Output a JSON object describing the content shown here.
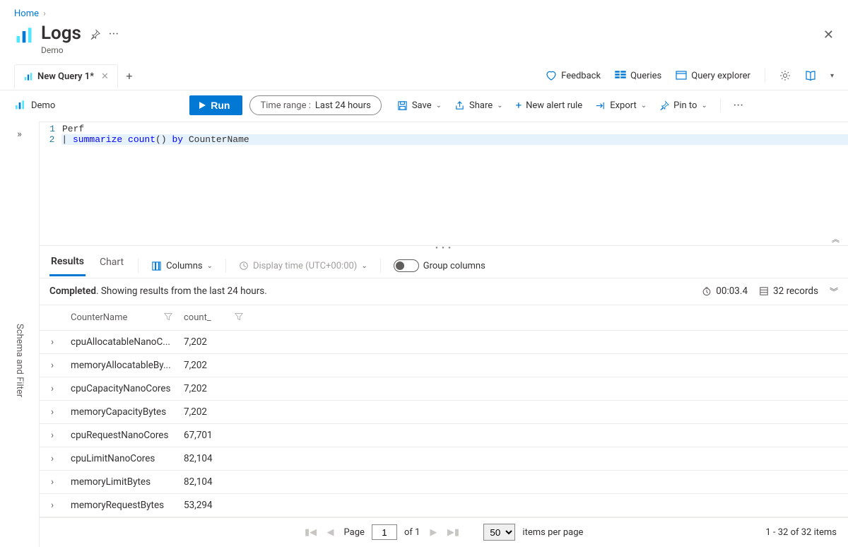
{
  "breadcrumb": {
    "home": "Home"
  },
  "page": {
    "title": "Logs",
    "subtitle": "Demo"
  },
  "tabs": {
    "active": "New Query 1*"
  },
  "topActions": {
    "feedback": "Feedback",
    "queries": "Queries",
    "queryExplorer": "Query explorer"
  },
  "cmdbar": {
    "scope": "Demo",
    "run": "Run",
    "timeRangeLabel": "Time range :",
    "timeRangeValue": "Last 24 hours",
    "save": "Save",
    "share": "Share",
    "newAlert": "New alert rule",
    "export": "Export",
    "pinTo": "Pin to"
  },
  "editor": {
    "lines": [
      {
        "n": "1",
        "segments": [
          {
            "t": "plain",
            "v": "Perf"
          }
        ]
      },
      {
        "n": "2",
        "segments": [
          {
            "t": "plain",
            "v": "| "
          },
          {
            "t": "kw",
            "v": "summarize"
          },
          {
            "t": "plain",
            "v": " "
          },
          {
            "t": "fn",
            "v": "count"
          },
          {
            "t": "plain",
            "v": "() "
          },
          {
            "t": "kw",
            "v": "by"
          },
          {
            "t": "plain",
            "v": " CounterName"
          }
        ]
      }
    ]
  },
  "results": {
    "tabs": {
      "results": "Results",
      "chart": "Chart"
    },
    "columnsBtn": "Columns",
    "displayTime": "Display time (UTC+00:00)",
    "groupColumns": "Group columns",
    "statusPrefix": "Completed",
    "statusRest": ". Showing results from the last 24 hours.",
    "elapsed": "00:03.4",
    "recordCount": "32 records",
    "headers": {
      "name": "CounterName",
      "count": "count_"
    },
    "rows": [
      {
        "name": "cpuAllocatableNanoC...",
        "count": "7,202"
      },
      {
        "name": "memoryAllocatableBy...",
        "count": "7,202"
      },
      {
        "name": "cpuCapacityNanoCores",
        "count": "7,202"
      },
      {
        "name": "memoryCapacityBytes",
        "count": "7,202"
      },
      {
        "name": "cpuRequestNanoCores",
        "count": "67,701"
      },
      {
        "name": "cpuLimitNanoCores",
        "count": "82,104"
      },
      {
        "name": "memoryLimitBytes",
        "count": "82,104"
      },
      {
        "name": "memoryRequestBytes",
        "count": "53,294"
      }
    ]
  },
  "pager": {
    "pageLabel": "Page",
    "page": "1",
    "ofLabel": "of 1",
    "perPage": "50",
    "itemsPerPage": "items per page",
    "summary": "1 - 32 of 32 items"
  },
  "side": {
    "label": "Schema and Filter"
  }
}
